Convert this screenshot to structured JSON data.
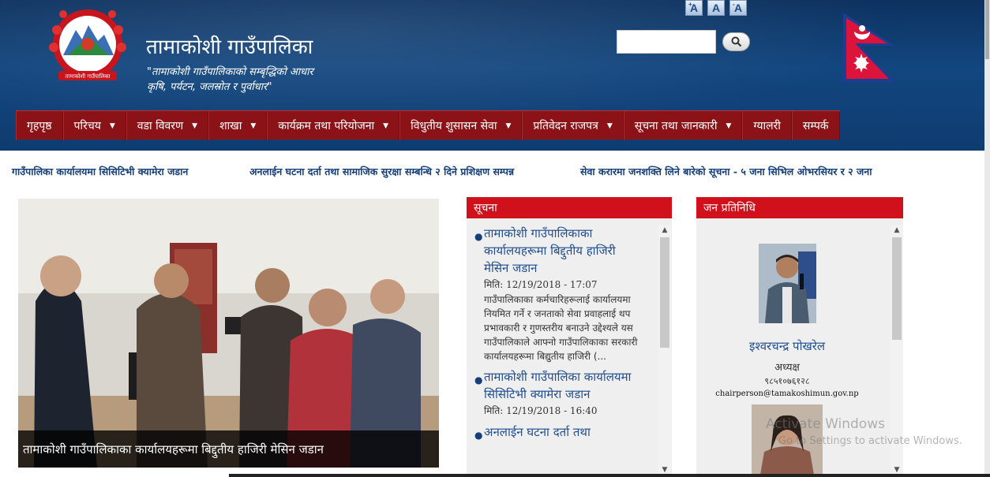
{
  "header": {
    "site_title": "तामाकोशी गाउँपालिका",
    "tagline_line1": "\"तामाकोशी गाउँपालिकाको सम्बृद्धिको आधार",
    "tagline_line2": "कृषि, पर्यटन, जलस्रोत र पुर्वाधार\"",
    "emblem_text": "तामाकोशी गाउँपालिका",
    "font_size_buttons": [
      "A",
      "A",
      "A"
    ],
    "search_placeholder": ""
  },
  "nav": {
    "items": [
      {
        "label": "गृहपृष्ठ",
        "dropdown": false
      },
      {
        "label": "परिचय",
        "dropdown": true
      },
      {
        "label": "वडा विवरण",
        "dropdown": true
      },
      {
        "label": "शाखा",
        "dropdown": true
      },
      {
        "label": "कार्यक्रम तथा परियोजना",
        "dropdown": true
      },
      {
        "label": "विधुतीय शुसासन सेवा",
        "dropdown": true
      },
      {
        "label": "प्रतिवेदन राजपत्र",
        "dropdown": true
      },
      {
        "label": "सूचना तथा जानकारी",
        "dropdown": true
      },
      {
        "label": "ग्यालरी",
        "dropdown": false
      },
      {
        "label": "सम्पर्क",
        "dropdown": false
      }
    ]
  },
  "ticker": {
    "items": [
      "गाउँपालिका कार्यालयमा सिसिटिभी क्यामेरा जडान",
      "अनलाईन घटना दर्ता तथा सामाजिक सुरक्षा सम्बन्धि २ दिने प्रशिक्षण सम्पन्न",
      "सेवा करारमा जनशक्ति लिने बारेको सूचना - ५ जना सिभिल ओभरसियर र २ जना"
    ]
  },
  "slider": {
    "caption": "तामाकोशी गाउँपालिकाका कार्यालयहरूमा बिद्दुतीय हाजिरी मेसिन जडान"
  },
  "notices": {
    "heading": "सूचना",
    "items": [
      {
        "title": "तामाकोशी गाउँपालिकाका कार्यालयहरूमा बिद्दुतीय हाजिरी मेसिन जडान",
        "date": "मिति: 12/19/2018 - 17:07",
        "excerpt": "गाउँपालिकाका कर्मचारिहरूलाई कार्यालयमा नियमित गर्ने र जनताको सेवा प्रवाहलाई थप प्रभावकारी र गुणस्तरीय बनाउने उद्देश्यले यस गाउँपालिकाले आफ्नो गाउँपालिकाका सरकारी कार्यालयहरूमा बिद्युतीय हाजिरी (..."
      },
      {
        "title": "तामाकोशी गाउँपालिका कार्यालयमा सिसिटिभी क्यामेरा जडान",
        "date": "मिति: 12/19/2018 - 16:40",
        "excerpt": ""
      },
      {
        "title": "अनलाईन घटना दर्ता तथा",
        "date": "",
        "excerpt": ""
      }
    ]
  },
  "representatives": {
    "heading": "जन प्रतिनिधि",
    "items": [
      {
        "name": "इश्वरचन्द्र पोखरेल",
        "role": "अध्यक्ष",
        "phone": "९८५१०७६१२८",
        "email": "chairperson@tamakoshimun.gov.np"
      }
    ]
  },
  "os_watermark": {
    "line1": "Activate Windows",
    "line2": "Go to Settings to activate Windows."
  },
  "colors": {
    "header_bg": "#12467f",
    "nav_bg": "#8b1317",
    "panel_head": "#d0101b",
    "link": "#1f4c8e"
  }
}
